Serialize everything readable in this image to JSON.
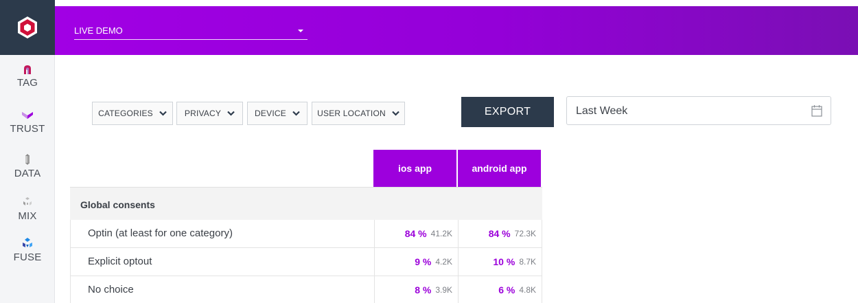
{
  "sidebar": {
    "items": [
      {
        "id": "tag",
        "label": "TAG",
        "icon": "tag-icon"
      },
      {
        "id": "trust",
        "label": "TRUST",
        "icon": "trust-icon"
      },
      {
        "id": "data",
        "label": "DATA",
        "icon": "data-icon"
      },
      {
        "id": "mix",
        "label": "MIX",
        "icon": "mix-icon"
      },
      {
        "id": "fuse",
        "label": "FUSE",
        "icon": "fuse-icon"
      }
    ]
  },
  "header": {
    "site_select": {
      "value": "LIVE DEMO"
    }
  },
  "filters": {
    "categories": "CATEGORIES",
    "privacy": "PRIVACY",
    "device": "DEVICE",
    "user_location": "USER LOCATION"
  },
  "toolbar": {
    "export_label": "EXPORT"
  },
  "date_range": {
    "value": "Last Week"
  },
  "table": {
    "columns": [
      "ios app",
      "android app"
    ],
    "group_label": "Global consents",
    "rows": [
      {
        "label": "Optin (at least for one category)",
        "cells": [
          {
            "pct": "84 %",
            "count": "41.2K"
          },
          {
            "pct": "84 %",
            "count": "72.3K"
          }
        ]
      },
      {
        "label": "Explicit optout",
        "cells": [
          {
            "pct": "9 %",
            "count": "4.2K"
          },
          {
            "pct": "10 %",
            "count": "8.7K"
          }
        ]
      },
      {
        "label": "No choice",
        "cells": [
          {
            "pct": "8 %",
            "count": "3.9K"
          },
          {
            "pct": "6 %",
            "count": "4.8K"
          }
        ]
      }
    ]
  },
  "colors": {
    "brand_purple": "#9d00dd",
    "sidebar_dark": "#2c3a4b",
    "logo_red": "#d0103a"
  }
}
